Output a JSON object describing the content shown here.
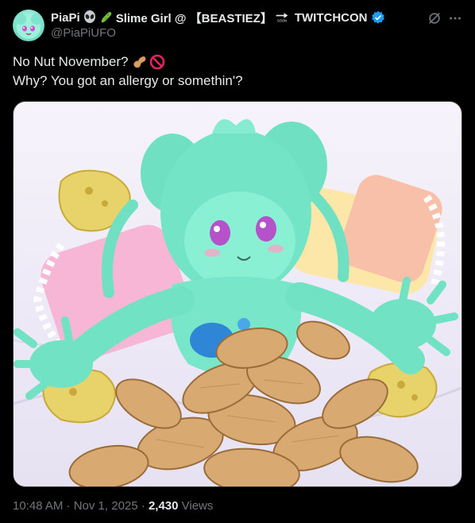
{
  "post": {
    "author": {
      "display_name": "PiaPi",
      "display_name_suffix": "Slime Girl @ 【BEASTIEZ】",
      "display_name_end": "TWITCHCON",
      "emoji_icons": [
        "alien-icon",
        "cucumber-icon",
        "soon-arrow-icon"
      ],
      "soon_label": "SOON",
      "handle": "@PiaPiUFO",
      "verified": true,
      "verified_color": "#1d9bf0"
    },
    "text_lines": [
      "No Nut November?",
      "Why? You got an allergy or somethin'?"
    ],
    "text_emoji_icons": [
      "peanut-icon",
      "prohibited-icon"
    ],
    "media": {
      "icon": "slime-girl-peanuts-image"
    },
    "timestamp": "10:48 AM · Nov 1, 2025 · ",
    "views_count": "2,430",
    "views_label": " Views"
  },
  "colors": {
    "background": "#000000",
    "text": "#e7e9ea",
    "muted": "#71767b",
    "border": "#2f3336"
  }
}
